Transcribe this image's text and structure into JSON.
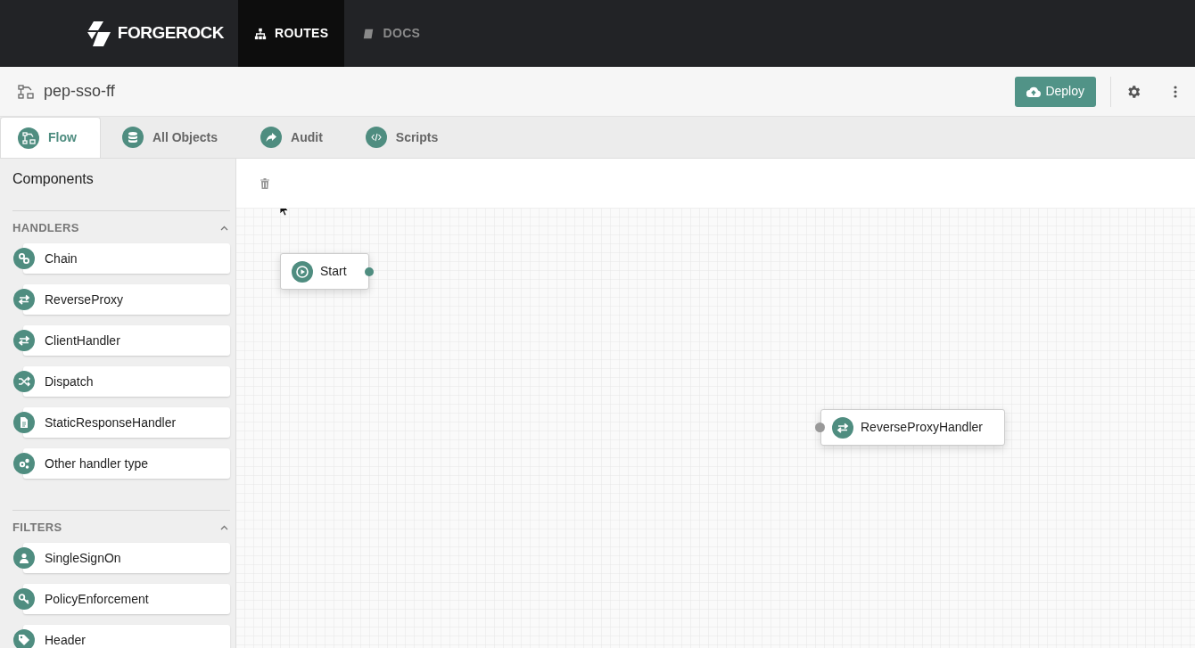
{
  "topbar": {
    "brand": "FORGEROCK",
    "nav": [
      {
        "label": "ROUTES",
        "selected": true,
        "kind": "sitemap"
      },
      {
        "label": "DOCS",
        "selected": false,
        "kind": "book"
      }
    ]
  },
  "header": {
    "title": "pep-sso-ff",
    "deploy": "Deploy"
  },
  "tabs": [
    {
      "label": "Flow",
      "selected": true,
      "kind": "flow"
    },
    {
      "label": "All Objects",
      "selected": false,
      "kind": "database"
    },
    {
      "label": "Audit",
      "selected": false,
      "kind": "share"
    },
    {
      "label": "Scripts",
      "selected": false,
      "kind": "code"
    }
  ],
  "sidebar": {
    "title": "Components",
    "sections": [
      {
        "title": "HANDLERS",
        "expanded": true,
        "items": [
          {
            "label": "Chain",
            "kind": "chain"
          },
          {
            "label": "ReverseProxy",
            "kind": "swap"
          },
          {
            "label": "ClientHandler",
            "kind": "swap"
          },
          {
            "label": "Dispatch",
            "kind": "shuffle"
          },
          {
            "label": "StaticResponseHandler",
            "kind": "document"
          },
          {
            "label": "Other handler type",
            "kind": "gears"
          }
        ]
      },
      {
        "title": "FILTERS",
        "expanded": true,
        "items": [
          {
            "label": "SingleSignOn",
            "kind": "user"
          },
          {
            "label": "PolicyEnforcement",
            "kind": "key"
          },
          {
            "label": "Header",
            "kind": "tag"
          }
        ]
      }
    ]
  },
  "canvas": {
    "nodes": [
      {
        "label": "Start",
        "kind": "start"
      },
      {
        "label": "ReverseProxyHandler",
        "kind": "swap"
      }
    ]
  }
}
